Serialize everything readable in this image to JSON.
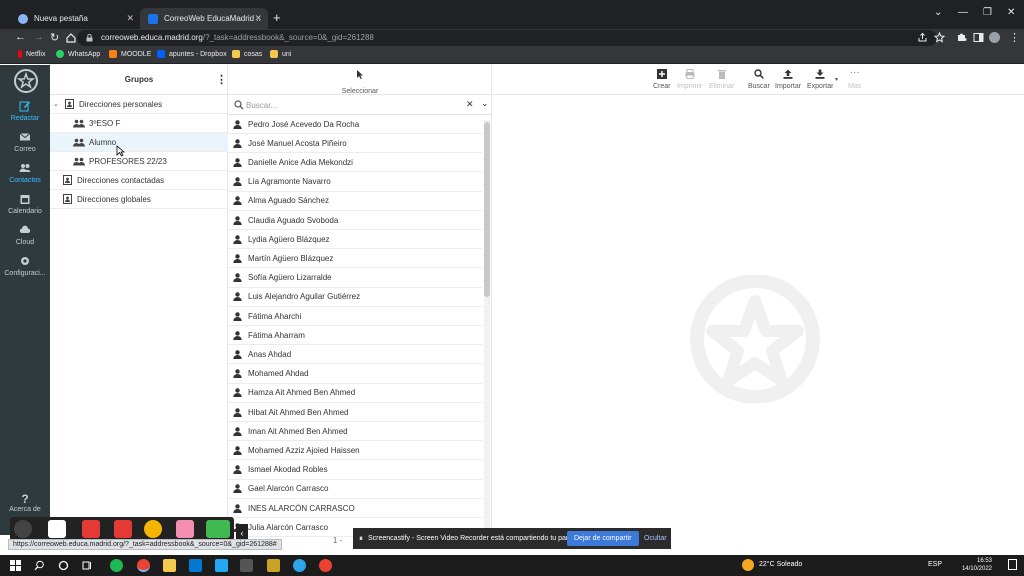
{
  "browser": {
    "tabs": [
      {
        "title": "Nueva pestaña",
        "active": false
      },
      {
        "title": "CorreoWeb EducaMadrid :: Conta",
        "active": true
      }
    ],
    "url_host": "correoweb.educa.madrid.org",
    "url_path": "/?_task=addressbook&_source=0&_gid=261288",
    "bookmarks": [
      "Netflix",
      "WhatsApp",
      "MOODLE",
      "apuntes - Dropbox",
      "cosas",
      "uni"
    ]
  },
  "nav": {
    "items": [
      {
        "label": "Redactar",
        "icon": "pencil-icon",
        "active": true
      },
      {
        "label": "Correo",
        "icon": "mail-icon",
        "active": false
      },
      {
        "label": "Contactos",
        "icon": "users-icon",
        "active": true
      },
      {
        "label": "Calendario",
        "icon": "calendar-icon",
        "active": false
      },
      {
        "label": "Cloud",
        "icon": "cloud-icon",
        "active": false
      },
      {
        "label": "Configuraci...",
        "icon": "gear-icon",
        "active": false
      }
    ],
    "about_label": "Acerca de"
  },
  "groups": {
    "title": "Grupos",
    "items": [
      {
        "label": "Direcciones personales",
        "level": 0,
        "icon": "book-icon"
      },
      {
        "label": "3ºESO F",
        "level": 1,
        "icon": "group-icon"
      },
      {
        "label": "Alumno",
        "level": 1,
        "icon": "group-icon",
        "selected": true
      },
      {
        "label": "PROFESORES 22/23",
        "level": 1,
        "icon": "group-icon"
      },
      {
        "label": "Direcciones contactadas",
        "level": 0,
        "icon": "book-icon"
      },
      {
        "label": "Direcciones globales",
        "level": 0,
        "icon": "book-icon"
      }
    ]
  },
  "contacts": {
    "select_label": "Seleccionar",
    "search_placeholder": "Buscar...",
    "list": [
      "Pedro José Acevedo Da Rocha",
      "José Manuel Acosta Piñeiro",
      "Danielle Anice Adia Mekondzi",
      "Lía Agramonte Navarro",
      "Alma Aguado Sánchez",
      "Claudia Aguado Svoboda",
      "Lydia Agüero Blázquez",
      "Martín Agüero Blázquez",
      "Sofía Agüero Lizarralde",
      "Luis Alejandro Aguilar Gutiérrez",
      "Fátima Aharchi",
      "Fátima Aharram",
      "Anas Ahdad",
      "Mohamed Ahdad",
      "Hamza Ait Ahmed Ben Ahmed",
      "Hibat Ait Ahmed Ben Ahmed",
      "Iman Ait Ahmed Ben Ahmed",
      "Mohamed Azziz Ajoied Haissen",
      "Ismael Akodad Robles",
      "Gael Alarcón Carrasco",
      "INES ALARCÓN CARRASCO",
      "Julia Alarcón Carrasco"
    ],
    "pager_text": "1 -"
  },
  "toolbar": {
    "items": [
      {
        "label": "Crear",
        "icon": "plus-square-icon",
        "enabled": true
      },
      {
        "label": "Imprimir",
        "icon": "printer-icon",
        "enabled": false
      },
      {
        "label": "Eliminar",
        "icon": "trash-icon",
        "enabled": false
      },
      {
        "label": "Buscar",
        "icon": "search-icon",
        "enabled": true
      },
      {
        "label": "Importar",
        "icon": "upload-icon",
        "enabled": true
      },
      {
        "label": "Exportar",
        "icon": "download-icon",
        "enabled": true
      },
      {
        "label": "Más",
        "icon": "more-icon",
        "enabled": false
      }
    ]
  },
  "overlay": {
    "status_url": "https://correoweb.educa.madrid.org/?_task=addressbook&_source=0&_gid=261288#",
    "cast_text": "Screencastify - Screen Video Recorder está compartiendo tu pantalla.",
    "cast_stop": "Dejar de compartir",
    "cast_hide": "Ocultar"
  },
  "taskbar": {
    "weather": "22°C Soleado",
    "lang": "ESP",
    "time": "16:53",
    "date": "14/10/2022"
  },
  "colors": {
    "accent": "#37beff",
    "nav_bg": "#2f3a3f",
    "selected_row": "#eaf5fb"
  }
}
